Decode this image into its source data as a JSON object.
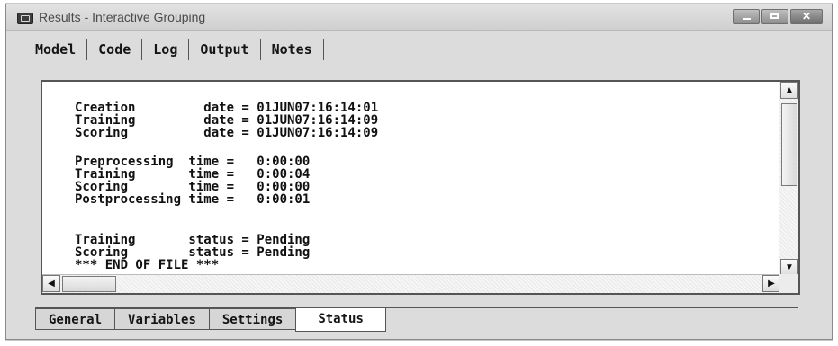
{
  "window": {
    "title": "Results - Interactive Grouping",
    "controls": [
      "minimize-icon",
      "maximize-icon",
      "close-icon"
    ]
  },
  "top_tabs": [
    "Model",
    "Code",
    "Log",
    "Output",
    "Notes"
  ],
  "status_lines": [
    "Creation         date = 01JUN07:16:14:01",
    "Training         date = 01JUN07:16:14:09",
    "Scoring          date = 01JUN07:16:14:09",
    "",
    "Preprocessing  time =   0:00:00",
    "Training       time =   0:00:04",
    "Scoring        time =   0:00:00",
    "Postprocessing time =   0:00:01",
    "",
    "",
    "Training       status = Pending",
    "Scoring        status = Pending",
    "*** END OF FILE ***"
  ],
  "scrollbar": {
    "up_arrow": "▲",
    "down_arrow": "▼",
    "left_arrow": "◀",
    "right_arrow": "▶"
  },
  "bottom_tabs": [
    "General",
    "Variables",
    "Settings",
    "Status"
  ],
  "active_bottom_tab": "Status"
}
